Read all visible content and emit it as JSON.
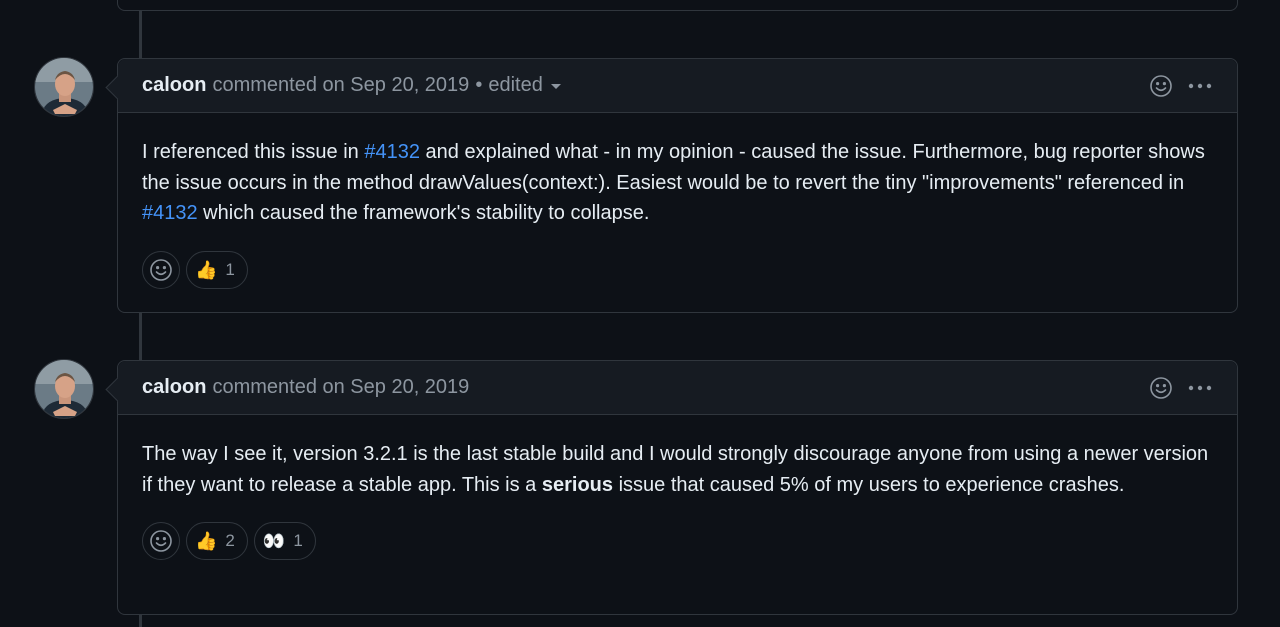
{
  "comments": [
    {
      "author": "caloon",
      "meta": "commented on Sep 20, 2019",
      "dot": "•",
      "edited": "edited",
      "body": {
        "t1": "I referenced this issue in ",
        "link1": "#4132",
        "t2": " and explained what - in my opinion - caused the issue. Furthermore, bug reporter shows the issue occurs in the method drawValues(context:). Easiest would be to revert the tiny \"improvements\" referenced in ",
        "link2": "#4132",
        "t3": " which caused the framework's stability to collapse."
      },
      "reactions": [
        {
          "icon": "thumbs-up-icon",
          "emoji": "👍",
          "count": "1"
        }
      ]
    },
    {
      "author": "caloon",
      "meta": "commented on Sep 20, 2019",
      "body": {
        "t1": "The way I see it, version 3.2.1 is the last stable build and I would strongly discourage anyone from using a newer version if they want to release a stable app. This is a ",
        "bold": "serious",
        "t2": " issue that caused 5% of my users to experience crashes."
      },
      "reactions": [
        {
          "icon": "thumbs-up-icon",
          "emoji": "👍",
          "count": "2"
        },
        {
          "icon": "eyes-icon",
          "emoji": "👀",
          "count": "1"
        }
      ]
    }
  ]
}
